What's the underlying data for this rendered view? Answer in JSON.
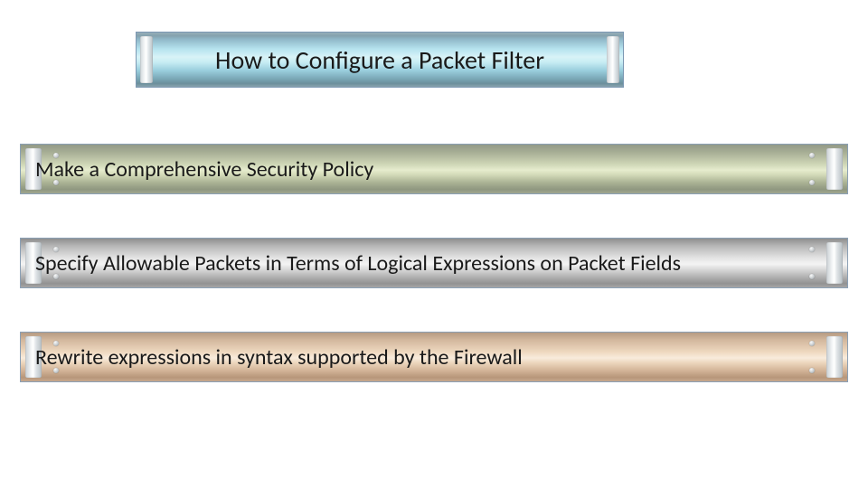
{
  "title": "How to Configure a Packet Filter",
  "steps": [
    "Make a Comprehensive Security Policy",
    "Specify Allowable Packets in Terms of Logical Expressions on Packet Fields",
    "Rewrite expressions in syntax supported by the Firewall"
  ]
}
